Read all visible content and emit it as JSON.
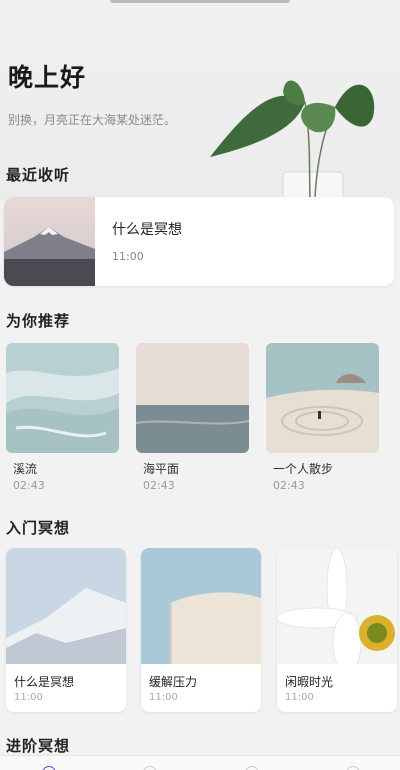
{
  "header": {
    "greeting": "晚上好",
    "subtitle": "别换，月亮正在大海某处迷茫。"
  },
  "recent": {
    "title": "最近收听",
    "item": {
      "name": "什么是冥想",
      "time": "11:00"
    }
  },
  "recommend": {
    "title": "为你推荐",
    "items": [
      {
        "name": "溪流",
        "time": "02:43"
      },
      {
        "name": "海平面",
        "time": "02:43"
      },
      {
        "name": "一个人散步",
        "time": "02:43"
      }
    ]
  },
  "intro": {
    "title": "入门冥想",
    "items": [
      {
        "name": "什么是冥想",
        "time": "11:00"
      },
      {
        "name": "缓解压力",
        "time": "11:00"
      },
      {
        "name": "闲暇时光",
        "time": "11:00"
      }
    ]
  },
  "advanced": {
    "title": "进阶冥想"
  },
  "icons": [
    "plant-illustration",
    "home-icon",
    "tab-icon-2",
    "tab-icon-3",
    "tab-icon-4"
  ],
  "colors": {
    "accent": "#5b4bd6",
    "background": "#f2f2f2",
    "card": "#ffffff"
  }
}
